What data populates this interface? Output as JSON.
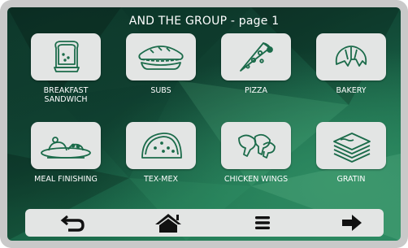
{
  "header": {
    "title": "AND THE GROUP - page 1"
  },
  "tiles": [
    {
      "label": "BREAKFAST SANDWICH",
      "icon": "sandwich-icon"
    },
    {
      "label": "SUBS",
      "icon": "sub-sandwich-icon"
    },
    {
      "label": "PIZZA",
      "icon": "pizza-slice-icon"
    },
    {
      "label": "BAKERY",
      "icon": "croissant-icon"
    },
    {
      "label": "MEAL FINISHING",
      "icon": "plated-meal-icon"
    },
    {
      "label": "TEX-MEX",
      "icon": "taco-icon"
    },
    {
      "label": "CHICKEN WINGS",
      "icon": "chicken-wings-icon"
    },
    {
      "label": "GRATIN",
      "icon": "gratin-layers-icon"
    }
  ],
  "navbar": {
    "buttons": [
      {
        "icon": "back-arrow-icon"
      },
      {
        "icon": "home-icon"
      },
      {
        "icon": "menu-icon"
      },
      {
        "icon": "forward-arrow-icon"
      }
    ]
  },
  "colors": {
    "tile_background": "#e3e5e4",
    "icon_stroke": "#1b6b4a",
    "nav_icon": "#111111",
    "background_dark": "#0b2a22",
    "background_light": "#2c8a63"
  }
}
